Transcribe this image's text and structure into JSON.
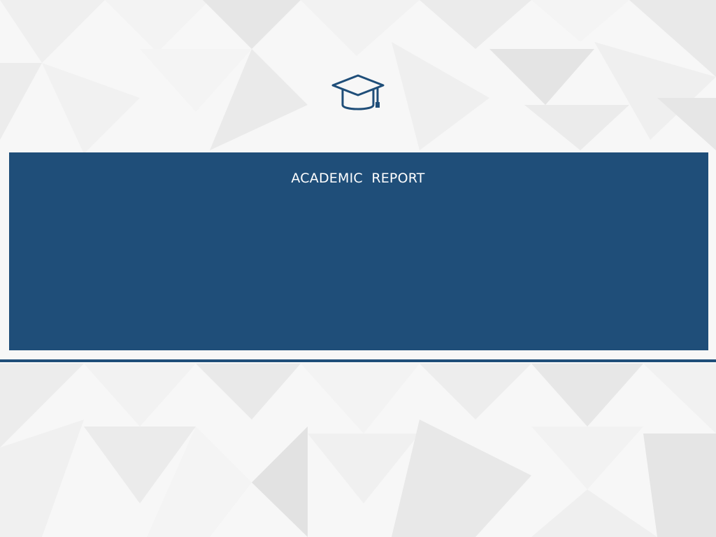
{
  "slide": {
    "title": "ACADEMIC  REPORT",
    "icon": "graduation-cap-icon"
  },
  "colors": {
    "accent": "#1f4e79",
    "title_text": "#ffffff",
    "background": "#f6f6f6"
  }
}
